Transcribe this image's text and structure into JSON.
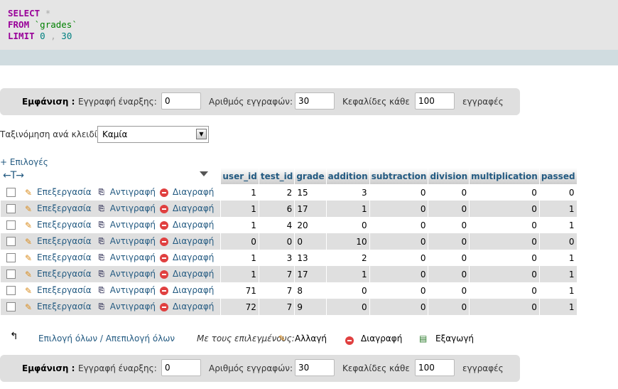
{
  "sql": {
    "select": "SELECT",
    "star": "*",
    "from": "FROM",
    "table": "`grades`",
    "limit": "LIMIT",
    "offset": "0",
    "comma": ",",
    "count": "30"
  },
  "nav": {
    "show_label": "Εμφάνιση :",
    "start_label": "Εγγραφή έναρξης:",
    "start_value": "0",
    "rows_label": "Αριθμός εγγραφών:",
    "rows_value": "30",
    "headers_label": "Κεφαλίδες κάθε",
    "headers_value": "100",
    "records_label": "εγγραφές"
  },
  "sort": {
    "label": "Ταξινόμηση ανά κλειδί:",
    "value": "Καμία"
  },
  "options_link": "+ Επιλογές",
  "arrows": "←T→",
  "columns": [
    "user_id",
    "test_id",
    "grade",
    "addition",
    "subtraction",
    "division",
    "multiplication",
    "passed"
  ],
  "actions": {
    "edit": "Επεξεργασία",
    "copy": "Αντιγραφή",
    "delete": "Διαγραφή"
  },
  "rows": [
    [
      "1",
      "2",
      "15",
      "3",
      "0",
      "0",
      "0",
      "0"
    ],
    [
      "1",
      "6",
      "17",
      "1",
      "0",
      "0",
      "0",
      "1"
    ],
    [
      "1",
      "4",
      "20",
      "0",
      "0",
      "0",
      "0",
      "1"
    ],
    [
      "0",
      "0",
      "0",
      "10",
      "0",
      "0",
      "0",
      "0"
    ],
    [
      "1",
      "3",
      "13",
      "2",
      "0",
      "0",
      "0",
      "1"
    ],
    [
      "1",
      "7",
      "17",
      "1",
      "0",
      "0",
      "0",
      "1"
    ],
    [
      "71",
      "7",
      "8",
      "0",
      "0",
      "0",
      "0",
      "1"
    ],
    [
      "72",
      "7",
      "9",
      "0",
      "0",
      "0",
      "0",
      "1"
    ]
  ],
  "bottom": {
    "select_all": "Επιλογή όλων / Απεπιλογή όλων",
    "with_selected": "Με τους επιλεγμένους:",
    "change": "Αλλαγή",
    "delete": "Διαγραφή",
    "export": "Εξαγωγή"
  },
  "colors": {
    "link": "#235a81",
    "keyword": "#990099",
    "string": "#008000",
    "number": "#008080"
  }
}
